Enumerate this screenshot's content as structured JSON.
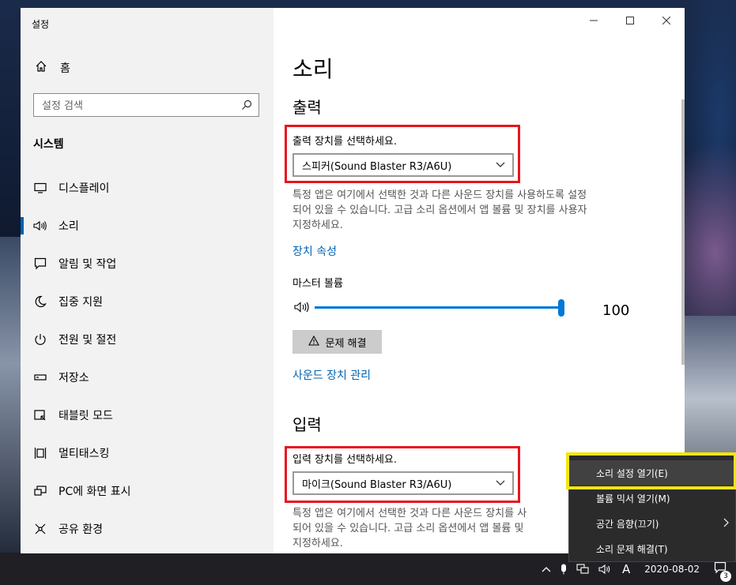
{
  "window": {
    "title": "설정"
  },
  "sidebar": {
    "home_label": "홈",
    "search_placeholder": "설정 검색",
    "section": "시스템",
    "items": [
      {
        "label": "디스플레이",
        "icon": "monitor-icon"
      },
      {
        "label": "소리",
        "icon": "speaker-icon",
        "active": true
      },
      {
        "label": "알림 및 작업",
        "icon": "message-icon"
      },
      {
        "label": "집중 지원",
        "icon": "moon-icon"
      },
      {
        "label": "전원 및 절전",
        "icon": "power-icon"
      },
      {
        "label": "저장소",
        "icon": "storage-icon"
      },
      {
        "label": "태블릿 모드",
        "icon": "tablet-icon"
      },
      {
        "label": "멀티태스킹",
        "icon": "multitask-icon"
      },
      {
        "label": "PC에 화면 표시",
        "icon": "project-icon"
      },
      {
        "label": "공유 환경",
        "icon": "share-icon"
      }
    ]
  },
  "main": {
    "title": "소리",
    "output": {
      "heading": "출력",
      "select_label": "출력 장치를 선택하세요.",
      "device": "스피커(Sound Blaster R3/A6U)",
      "desc_lines": [
        "특정 앱은 여기에서 선택한 것과 다른 사운드 장치를 사용하도록 설정",
        "되어 있을 수 있습니다. 고급 소리 옵션에서 앱 볼륨 및 장치를 사용자",
        "지정하세요."
      ],
      "properties_link": "장치 속성",
      "master_volume_label": "마스터 볼륨",
      "volume": "100",
      "volume_fraction": 1.0,
      "troubleshoot": "문제 해결",
      "manage_link": "사운드 장치 관리"
    },
    "input": {
      "heading": "입력",
      "select_label": "입력 장치를 선택하세요.",
      "device": "마이크(Sound Blaster R3/A6U)",
      "desc_lines": [
        "특정 앱은 여기에서 선택한 것과 다른 사운드 장치를 사",
        "되어 있을 수 있습니다. 고급 소리 옵션에서 앱 볼륨 및",
        "지정하세요."
      ]
    }
  },
  "context_menu": {
    "items": [
      {
        "label": "소리 설정 열기(E)"
      },
      {
        "label": "볼륨 믹서 열기(M)"
      },
      {
        "label": "공간 음향(끄기)"
      },
      {
        "label": "소리 문제 해결(T)"
      }
    ]
  },
  "taskbar": {
    "ime": "A",
    "date": "2020-08-02",
    "notification_count": "3"
  },
  "colors": {
    "accent": "#0078d7",
    "highlight_red": "#e8141e",
    "highlight_yellow": "#f2e612"
  }
}
